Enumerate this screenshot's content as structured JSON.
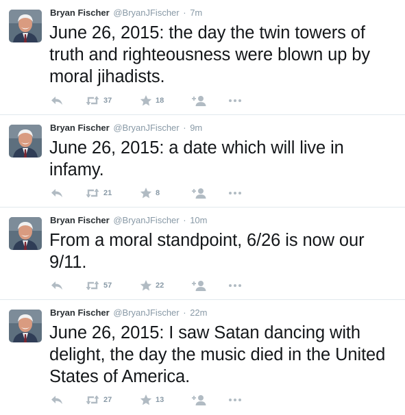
{
  "tweets": [
    {
      "name": "Bryan Fischer",
      "handle": "@BryanJFischer",
      "sep": "·",
      "time": "7m",
      "text": "June 26, 2015: the day the twin towers of truth and righteousness were blown up by moral jihadists.",
      "retweets": "37",
      "favorites": "18"
    },
    {
      "name": "Bryan Fischer",
      "handle": "@BryanJFischer",
      "sep": "·",
      "time": "9m",
      "text": "June 26, 2015: a date which will live in infamy.",
      "retweets": "21",
      "favorites": "8"
    },
    {
      "name": "Bryan Fischer",
      "handle": "@BryanJFischer",
      "sep": "·",
      "time": "10m",
      "text": "From a moral standpoint, 6/26 is now our 9/11.",
      "retweets": "57",
      "favorites": "22"
    },
    {
      "name": "Bryan Fischer",
      "handle": "@BryanJFischer",
      "sep": "·",
      "time": "22m",
      "text": "June 26, 2015: I saw Satan dancing with delight, the day the music died in the United States of America.",
      "retweets": "27",
      "favorites": "13"
    }
  ],
  "icons": {
    "reply": "reply-icon",
    "retweet": "retweet-icon",
    "favorite": "star-icon",
    "follow": "follow-icon",
    "more": "more-icon"
  },
  "colors": {
    "icon": "#b1bbc3",
    "meta": "#8899a6",
    "text": "#14171a",
    "divider": "#e1e8ed"
  }
}
